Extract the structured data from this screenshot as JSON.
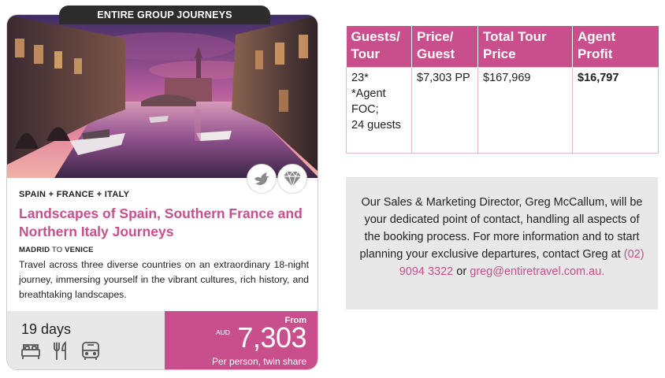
{
  "card": {
    "ribbon": "ENTIRE GROUP JOURNEYS",
    "countries": "SPAIN + FRANCE + ITALY",
    "title": "Landscapes of Spain, Southern France and Northern Italy Journeys",
    "route": {
      "from": "MADRID",
      "to_word": "TO",
      "to": "VENICE"
    },
    "description": "Travel across three diverse countries on an extraordinary 18-night journey, immersing yourself in the vibrant cultures, rich history, and breathtaking landscapes.",
    "badges": [
      "bird-icon",
      "diamond-icon"
    ],
    "duration": "19 days",
    "facility_icons": [
      "bed-icon",
      "dining-icon",
      "coach-icon"
    ],
    "price": {
      "from_label": "From",
      "currency": "AUD",
      "amount": "7,303",
      "note": "Per person, twin share"
    },
    "colors": {
      "accent": "#c94f8c",
      "footer_bg": "#e8e8e8",
      "ribbon_bg": "#2c2c2c"
    }
  },
  "table": {
    "headers": [
      "Guests/ Tour",
      "Price/ Guest",
      "Total Tour Price",
      "Agent Profit"
    ],
    "row": {
      "guests_lines": [
        "23*",
        "*Agent",
        "FOC;",
        "24 guests"
      ],
      "price_per_guest": "$7,303 PP",
      "total_price": "$167,969",
      "agent_profit": "$16,797"
    }
  },
  "contact": {
    "text_before_phone": "Our Sales & Marketing Director, Greg McCallum, will be your dedicated point of contact, handling all aspects of the booking process. For more information and to start planning your exclusive departures, contact Greg at",
    "phone": "(02) 9094 3322",
    "or_word": "or",
    "email": "greg@entiretravel.com.au."
  }
}
